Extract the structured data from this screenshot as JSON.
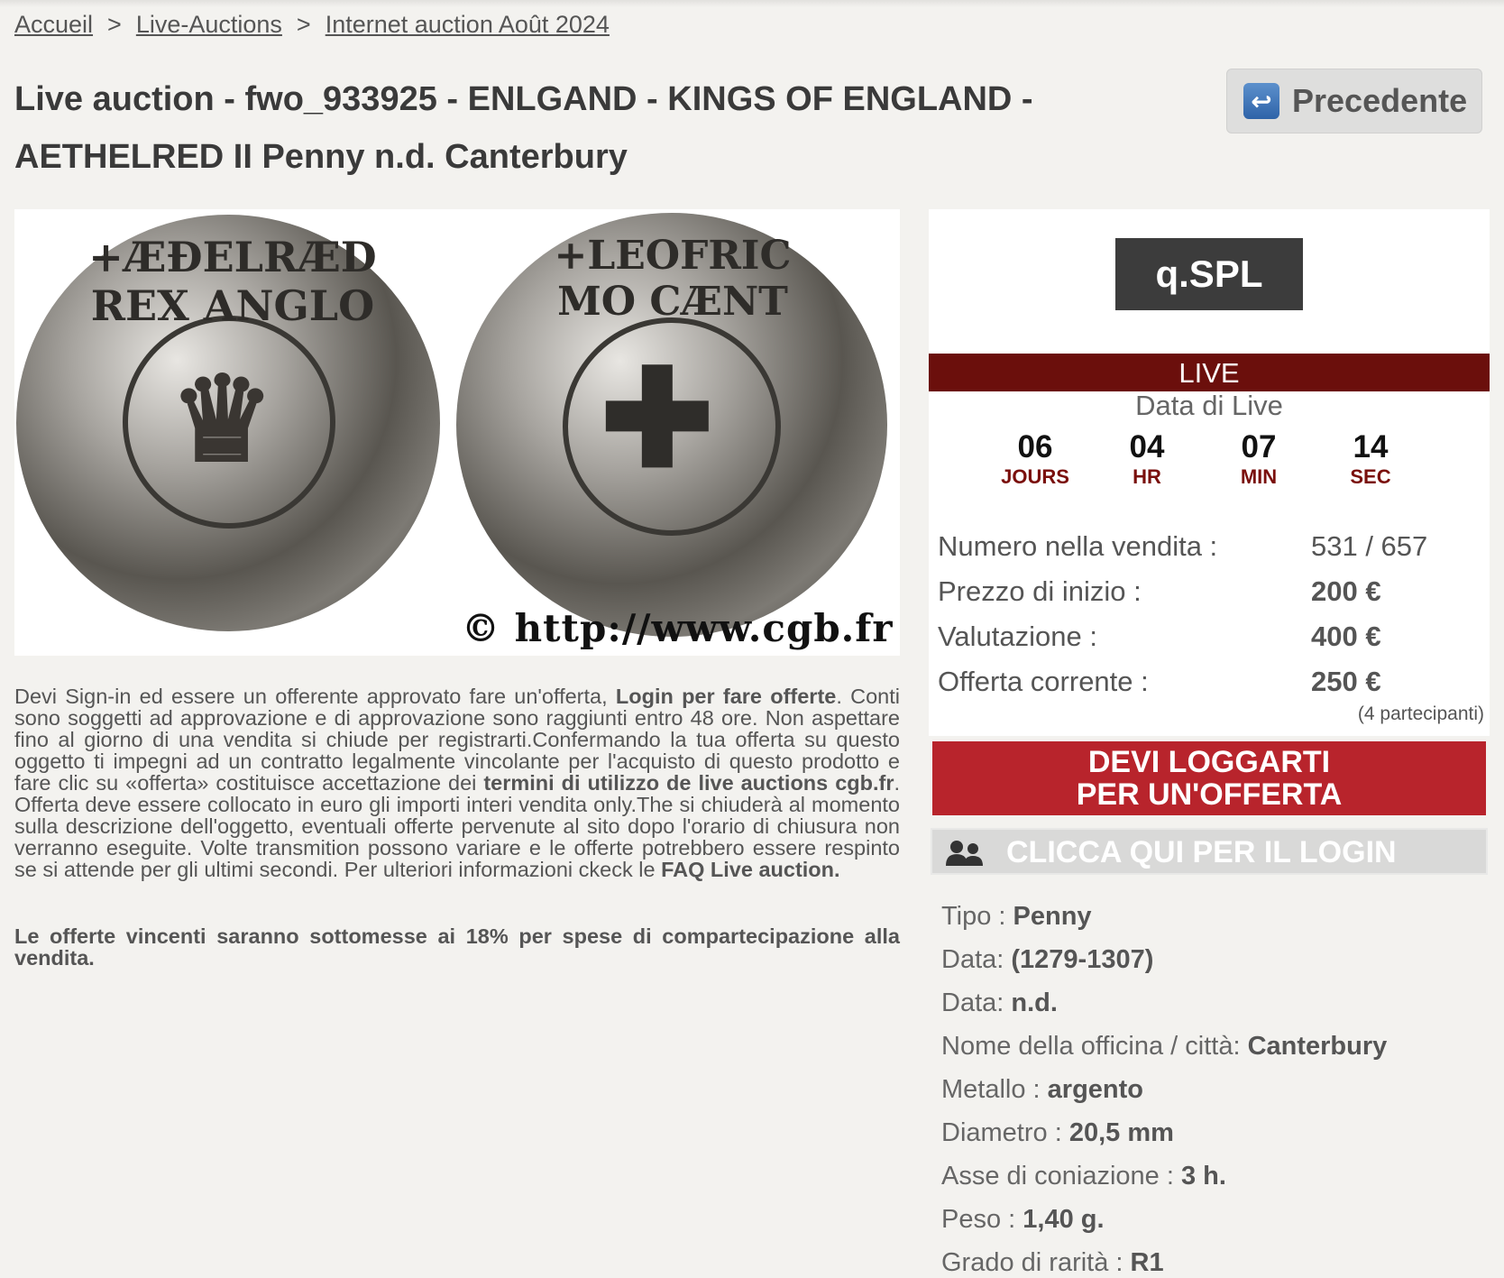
{
  "breadcrumb": {
    "items": [
      "Accueil",
      "Live-Auctions",
      "Internet auction Août 2024"
    ],
    "separator": ">"
  },
  "page_title": "Live auction - fwo_933925 - ENLGAND - KINGS OF ENGLAND - AETHELRED II Penny n.d. Canterbury",
  "prev_button": {
    "label": "Precedente"
  },
  "image": {
    "watermark": "© http://www.cgb.fr",
    "obverse_legend": "+ÆÐELRÆD REX ANGLO",
    "reverse_legend": "+LEOFRIC MO CÆNT"
  },
  "description": {
    "p1_a": "Devi Sign-in ed essere un offerente approvato fare un'offerta, ",
    "p1_b": "Login per fare offerte",
    "p1_c": ". Conti sono soggetti ad approvazione e di approvazione sono raggiunti entro 48 ore. Non aspettare fino al giorno di una vendita si chiude per registrarti.Confermando la tua offerta su questo oggetto ti impegni ad un contratto legalmente vincolante per l'acquisto di questo prodotto e fare clic su «offerta» costituisce accettazione dei ",
    "p1_d": "termini di utilizzo de live auctions cgb.fr",
    "p1_e": ". Offerta deve essere collocato in euro gli importi interi vendita only.The si chiuderà al momento sulla descrizione dell'oggetto, eventuali offerte pervenute al sito dopo l'orario di chiusura non verranno eseguite. Volte transmition possono variare e le offerte potrebbero essere respinto se si attende per gli ultimi secondi. Per ulteriori informazioni ckeck le ",
    "p1_f": "FAQ Live auction.",
    "p2": "Le offerte vincenti saranno sottomesse ai 18% per spese di compartecipazione alla vendita."
  },
  "panel": {
    "grade": "q.SPL",
    "live_label": "LIVE",
    "live_date_label": "Data di Live",
    "countdown": [
      {
        "value": "06",
        "unit": "JOURS"
      },
      {
        "value": "04",
        "unit": "HR"
      },
      {
        "value": "07",
        "unit": "MIN"
      },
      {
        "value": "14",
        "unit": "SEC"
      }
    ],
    "info": [
      {
        "label": "Numero nella vendita :",
        "value": "531 / 657"
      },
      {
        "label": "Prezzo di inizio :",
        "value": "200 €"
      },
      {
        "label": "Valutazione :",
        "value": "400 €"
      },
      {
        "label": "Offerta corrente :",
        "value": "250 €"
      }
    ],
    "bidders": "(4 partecipanti)"
  },
  "login_required": "DEVI LOGGARTI PER UN'OFFERTA",
  "login_click": "CLICCA QUI PER IL LOGIN",
  "specs": [
    {
      "label": "Tipo : ",
      "value": "Penny"
    },
    {
      "label": "Data: ",
      "value": "(1279-1307)"
    },
    {
      "label": "Data: ",
      "value": "n.d."
    },
    {
      "label": "Nome della officina / città: ",
      "value": "Canterbury"
    },
    {
      "label": "Metallo : ",
      "value": "argento"
    },
    {
      "label": "Diametro : ",
      "value": "20,5 mm"
    },
    {
      "label": "Asse di coniazione : ",
      "value": "3 h."
    },
    {
      "label": "Peso : ",
      "value": "1,40 g."
    },
    {
      "label": "Grado di rarità : ",
      "value": "R1"
    }
  ],
  "colors": {
    "live_bar": "#6b0f0c",
    "login_button": "#b8242c",
    "countdown_unit": "#7a0f0c",
    "grade_badge": "#3c3c3c"
  }
}
